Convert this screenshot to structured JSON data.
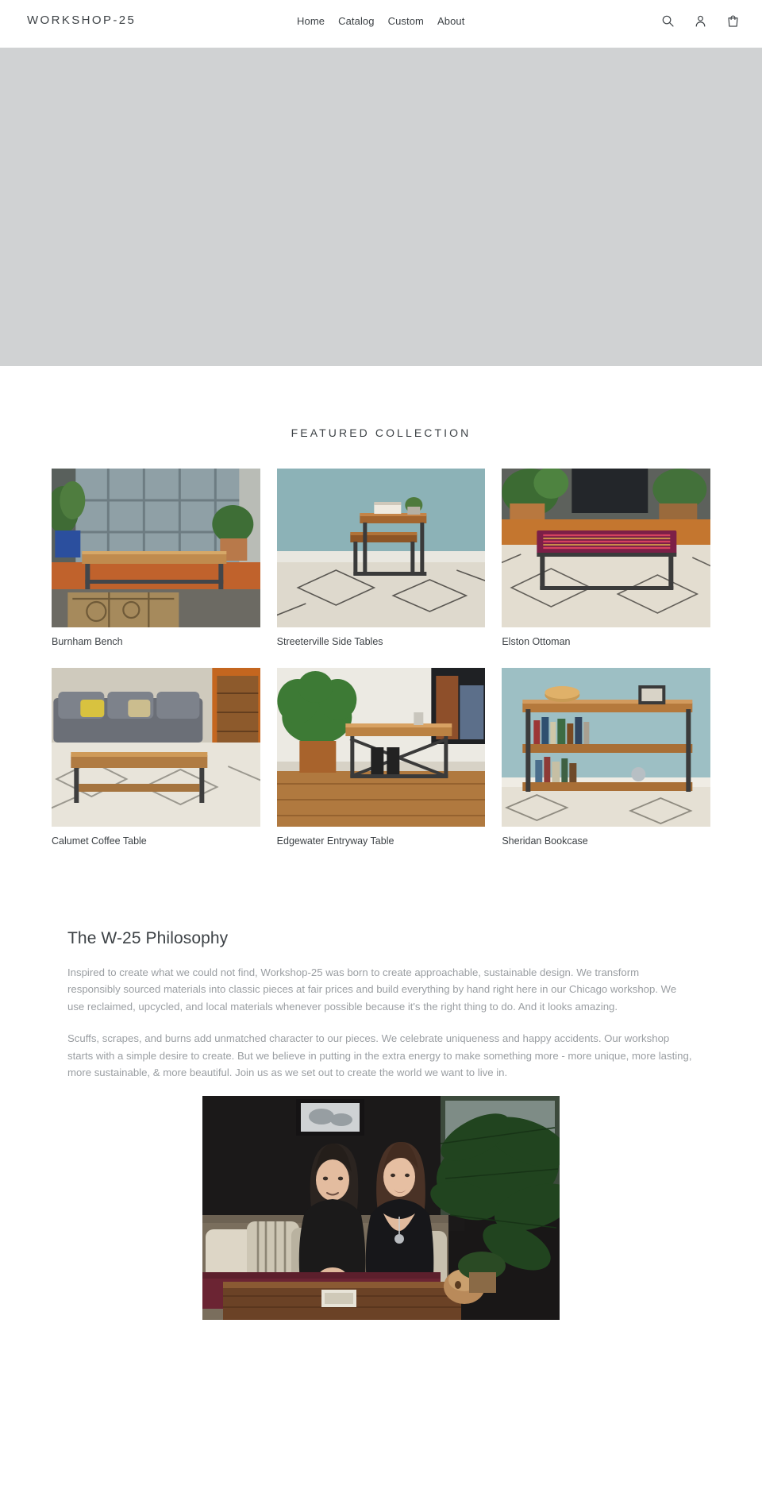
{
  "header": {
    "logo": "WORKSHOP-25",
    "nav": [
      {
        "label": "Home"
      },
      {
        "label": "Catalog"
      },
      {
        "label": "Custom"
      },
      {
        "label": "About"
      }
    ],
    "icons": [
      {
        "name": "search-icon",
        "label": "Search"
      },
      {
        "name": "account-icon",
        "label": "Log in"
      },
      {
        "name": "cart-icon",
        "label": "Cart"
      }
    ]
  },
  "hero": {
    "background_color": "#d0d2d3"
  },
  "featured": {
    "title": "FEATURED COLLECTION",
    "products": [
      {
        "title": "Burnham Bench"
      },
      {
        "title": "Streeterville Side Tables"
      },
      {
        "title": "Elston Ottoman"
      },
      {
        "title": "Calumet Coffee Table"
      },
      {
        "title": "Edgewater Entryway Table"
      },
      {
        "title": "Sheridan Bookcase"
      }
    ]
  },
  "philosophy": {
    "heading": "The W-25 Philosophy",
    "paragraph1": "Inspired to create what we could not find, Workshop-25 was born to create approachable, sustainable design. We transform responsibly sourced materials into classic pieces at fair prices and build everything by hand right here in our Chicago workshop. We use reclaimed, upcycled, and local materials whenever possible because it's the right thing to do. And it looks amazing.",
    "paragraph2": "Scuffs, scrapes, and burns add unmatched character to our pieces. We celebrate uniqueness and happy accidents. Our workshop starts with a simple desire to create. But we believe in putting in the extra energy to make something more - more unique, more lasting, more sustainable, & more beautiful. Join us as we set out to create the world we want to live in."
  },
  "colors": {
    "text_dark": "#3d4246",
    "text_muted": "#9a9ea2",
    "hero_gray": "#d0d2d3",
    "page_background": "#ffffff"
  }
}
